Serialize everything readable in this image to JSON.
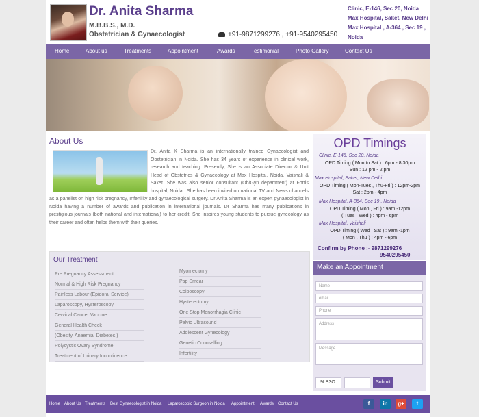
{
  "header": {
    "name": "Dr. Anita Sharma",
    "degrees": "M.B.B.S., M.D.",
    "specialty": "Obstetrician & Gynaecologist",
    "phones": "+91-9871299276 , +91-9540295450",
    "address_lines": [
      "Clinic, E-146, Sec 20, Noida",
      "Max Hospital, Saket, New Delhi",
      "Max Hospital , A-364 , Sec 19 ,",
      "Noida"
    ]
  },
  "nav": {
    "items": [
      "Home",
      "About us",
      "Treatments",
      "Appointment",
      "Awards",
      "Testimonial",
      "Photo Gallery",
      "Contact Us"
    ]
  },
  "about": {
    "title": "About Us",
    "text": "Dr. Anita K Sharma is an internationally trained Gynaecologist and Obstetrician in Noida. She has 34 years of experience in clinical work, research and teaching. Presently, She is an Associate Director & Unit Head of Obstetrics & Gynaecology at Max Hospital, Noida, Vaishali & Saket. She was also senior consultant (Ob/Gyn department) at Fortis hospital, Noida . She has been invited on national TV and News channels as a panelist on high risk pregnancy, Infertility and gynaecological surgery. Dr Anita Sharma is an expert gynaecologist in Noida having a number of awards and publication in international journals. Dr Sharma has many publications in prestigious journals (both national and international) to her credit. She inspires young students to pursue gynecology as their career and often helps them with their queries.."
  },
  "treatment": {
    "title": "Our Treatment",
    "left": [
      "Pre Pregnancy Assessment",
      "Normal & High Risk Pregnancy",
      "Painless Labour (Epidoral Service)",
      "Laparoscopy, Hysteroscopy",
      "Cervical Cancer Vaccine",
      "General Health Check",
      "(Obesity, Anaemia, Diabetes,)",
      "Polycystic Ovary Syndrome",
      "Treatment of Urinary Incontinence"
    ],
    "right": [
      "Myomectomy",
      "Pap Smear",
      "Colposcopy",
      "Hysterectomy",
      "One Stop Menorrhagia Clinic",
      "Pelvic Ultrasound",
      "Adolescent Gynecology",
      "Genetic Counselling",
      "Infertility"
    ]
  },
  "opd": {
    "title": "OPD Timings",
    "blocks": [
      {
        "loc": "Clinic, E-146, Sec 20, Noida",
        "lines": [
          "OPD Timing ( Mon to Sat ) :  6pm - 8:30pm",
          "Sun : 12 pm - 2 pm"
        ]
      },
      {
        "loc": "Max Hospital, Saket, New Delhi",
        "lines": [
          "OPD Timing ( Mon-Tues , Thu-Fri ) : 12pm-2pm",
          "Sat : 2pm - 4pm"
        ]
      },
      {
        "loc": "Max Hospital, A-364, Sec 19 , Noida",
        "lines": [
          "OPD Timing ( Mon , Fri ) : 9am -12pm",
          "( Tues , Wed ) : 4pm - 6pm"
        ]
      },
      {
        "loc": "Max Hospital, Vaishali",
        "lines": [
          "OPD Timing ( Wed , Sat ) : 9am -1pm",
          "( Mon , Thu ) : 4pm - 6pm"
        ]
      }
    ],
    "confirm": "Confirm by Phone :-  9871299276",
    "confirm2": "9540295450"
  },
  "appointment": {
    "title": "Make an Appointment",
    "name_ph": "Name",
    "email_ph": "email",
    "phone_ph": "Phone",
    "address_ph": "Address",
    "message_ph": "Message",
    "captcha": "9LB3O",
    "submit": "Submit"
  },
  "footer": {
    "items": [
      "Home",
      "About Us",
      "Treatments",
      "Best Gynaecologist in Noida",
      "Laparoscopic Surgeon in Noida",
      "Appointment",
      "Awards",
      "Contact Us"
    ],
    "social": [
      "f",
      "in",
      "g+",
      "t"
    ]
  },
  "colors": {
    "brand": "#7b66a6",
    "brand_dark": "#6a4fa0",
    "title": "#5b3f8c"
  }
}
